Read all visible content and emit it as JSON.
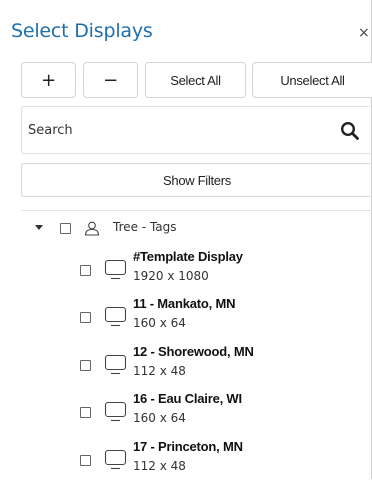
{
  "header": {
    "title": "Select Displays",
    "close_glyph": "×"
  },
  "toolbar": {
    "add_label": "+",
    "remove_label": "−",
    "select_all_label": "Select All",
    "unselect_all_label": "Unselect All"
  },
  "search": {
    "value": "Search",
    "icon": "search-icon"
  },
  "filters": {
    "label": "Show Filters"
  },
  "tree": {
    "group_label": "Tree - Tags",
    "items": [
      {
        "name": "#Template Display",
        "resolution": "1920 x 1080"
      },
      {
        "name": "11 - Mankato, MN",
        "resolution": "160 x 64"
      },
      {
        "name": "12 - Shorewood, MN",
        "resolution": "112 x 48"
      },
      {
        "name": "16 - Eau Claire, WI",
        "resolution": "160 x 64"
      },
      {
        "name": "17 - Princeton, MN",
        "resolution": "112 x 48"
      }
    ]
  },
  "colors": {
    "title": "#1f6fae",
    "border": "#d4d4d4"
  }
}
